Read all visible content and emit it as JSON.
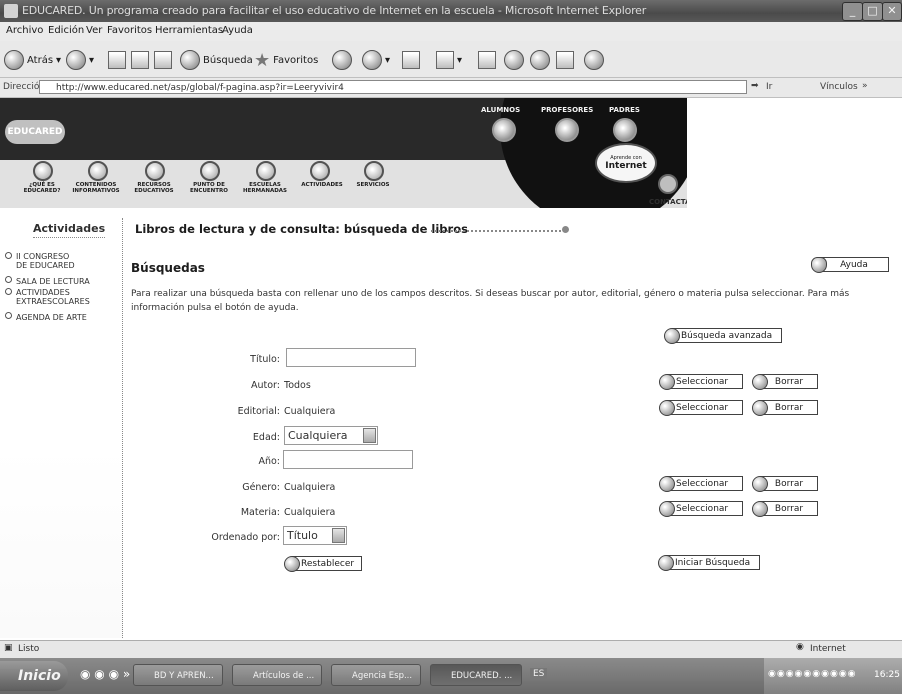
{
  "window": {
    "title": "EDUCARED. Un programa creado para facilitar el uso educativo de Internet en la escuela - Microsoft Internet Explorer"
  },
  "menu": [
    "Archivo",
    "Edición",
    "Ver",
    "Favoritos",
    "Herramientas",
    "Ayuda"
  ],
  "toolbar": {
    "back": "Atrás",
    "search": "Búsqueda",
    "favorites": "Favoritos"
  },
  "address": {
    "label": "Dirección",
    "url": "http://www.educared.net/asp/global/f-pagina.asp?ir=Leeryvivir4",
    "go": "Ir",
    "links": "Vínculos"
  },
  "banner": {
    "logo": "EDUCARED",
    "top_links": [
      "ALUMNOS",
      "PROFESORES",
      "PADRES"
    ],
    "nav": [
      "¿QUÉ ES EDUCARED?",
      "CONTENIDOS INFORMATIVOS",
      "RECURSOS EDUCATIVOS",
      "PUNTO DE ENCUENTRO",
      "ESCUELAS HERMANADAS",
      "ACTIVIDADES",
      "SERVICIOS"
    ],
    "aprende_small": "Aprende con",
    "aprende_big": "Internet",
    "contacta": "CONTACTA"
  },
  "sidebar": {
    "title": "Actividades",
    "items": [
      "II CONGRESO DE EDUCARED",
      "SALA DE LECTURA",
      "ACTIVIDADES EXTRAESCOLARES",
      "AGENDA DE ARTE"
    ]
  },
  "main": {
    "heading": "Libros de lectura y de consulta: búsqueda de libros",
    "section": "Búsquedas",
    "help": "Ayuda",
    "description": "Para realizar una búsqueda basta con rellenar uno de los campos descritos. Si deseas buscar por autor, editorial, género o materia pulsa seleccionar. Para más información pulsa el botón de ayuda.",
    "advanced": "Búsqueda avanzada",
    "select_label": "Seleccionar",
    "clear_label": "Borrar",
    "reset": "Restablecer",
    "start": "Iniciar Búsqueda",
    "fields": {
      "titulo": {
        "label": "Título:"
      },
      "autor": {
        "label": "Autor:",
        "value": "Todos"
      },
      "editorial": {
        "label": "Editorial:",
        "value": "Cualquiera"
      },
      "edad": {
        "label": "Edad:",
        "value": "Cualquiera"
      },
      "anio": {
        "label": "Año:"
      },
      "genero": {
        "label": "Género:",
        "value": "Cualquiera"
      },
      "materia": {
        "label": "Materia:",
        "value": "Cualquiera"
      },
      "orden": {
        "label": "Ordenado por:",
        "value": "Título"
      }
    }
  },
  "status": {
    "text": "Listo",
    "zone": "Internet"
  },
  "taskbar": {
    "start": "Inicio",
    "tasks": [
      "BD Y APREN...",
      "Artículos de ...",
      "Agencia Esp...",
      "EDUCARED. ..."
    ],
    "lang": "ES",
    "clock": "16:25"
  }
}
